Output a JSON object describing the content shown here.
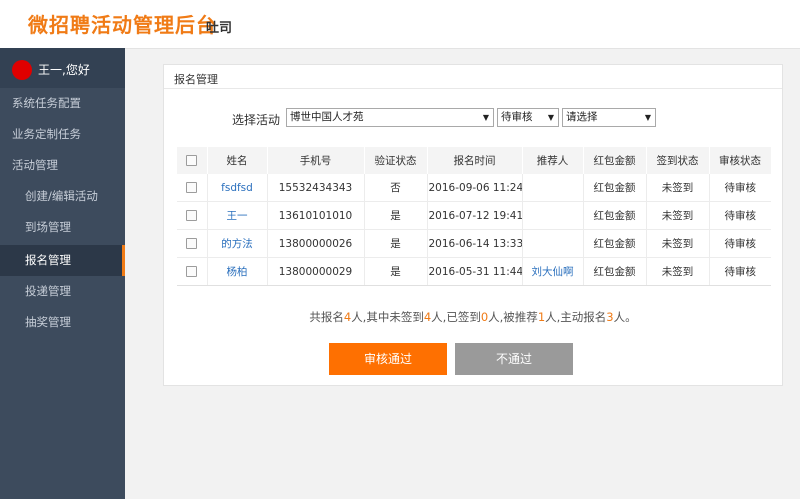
{
  "header": {
    "brand": "微招聘活动管理后台",
    "subtitle": "吐司"
  },
  "user": {
    "greeting": "王一,您好"
  },
  "sidebar": {
    "items": [
      {
        "label": "系统任务配置"
      },
      {
        "label": "业务定制任务"
      },
      {
        "label": "活动管理"
      },
      {
        "label": "创建/编辑活动"
      },
      {
        "label": "到场管理"
      },
      {
        "label": "报名管理"
      },
      {
        "label": "投递管理"
      },
      {
        "label": "抽奖管理"
      }
    ]
  },
  "panel": {
    "title": "报名管理",
    "filter": {
      "label": "选择活动",
      "activity": "博世中国人才苑",
      "status": "待审核",
      "extra": "请选择"
    },
    "table": {
      "headers": [
        "姓名",
        "手机号",
        "验证状态",
        "报名时间",
        "推荐人",
        "红包金额",
        "签到状态",
        "审核状态"
      ],
      "rows": [
        {
          "name": "fsdfsd",
          "phone": "15532434343",
          "verify": "否",
          "time": "2016-09-06 11:24",
          "referrer": "",
          "redpacket": "红包金额",
          "checkin": "未签到",
          "audit": "待审核"
        },
        {
          "name": "王一",
          "phone": "13610101010",
          "verify": "是",
          "time": "2016-07-12 19:41",
          "referrer": "",
          "redpacket": "红包金额",
          "checkin": "未签到",
          "audit": "待审核"
        },
        {
          "name": "的方法",
          "phone": "13800000026",
          "verify": "是",
          "time": "2016-06-14 13:33",
          "referrer": "",
          "redpacket": "红包金额",
          "checkin": "未签到",
          "audit": "待审核"
        },
        {
          "name": "杨柏",
          "phone": "13800000029",
          "verify": "是",
          "time": "2016-05-31 11:44",
          "referrer": "刘大仙啊",
          "redpacket": "红包金额",
          "checkin": "未签到",
          "audit": "待审核"
        }
      ]
    },
    "summary": {
      "t1": "共报名",
      "n1": "4",
      "t2": "人,其中未签到",
      "n2": "4",
      "t3": "人,已签到",
      "n3": "0",
      "t4": "人,被推荐",
      "n4": "1",
      "t5": "人,主动报名",
      "n5": "3",
      "t6": "人。"
    },
    "buttons": {
      "approve": "审核通过",
      "reject": "不通过"
    }
  },
  "colors": {
    "accent": "#f07b16",
    "sidebar": "#3d4b5d",
    "link": "#2a6fbd"
  }
}
